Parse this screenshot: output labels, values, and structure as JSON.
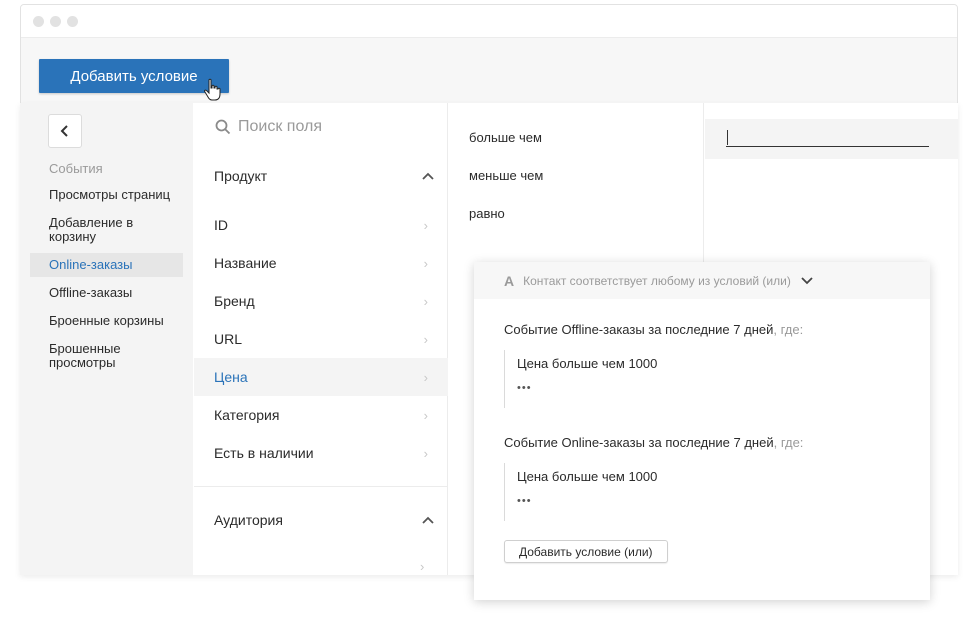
{
  "toolbar": {
    "add_condition_label": "Добавить условие"
  },
  "events_panel": {
    "heading": "События",
    "items": [
      {
        "label": "Просмотры страниц"
      },
      {
        "label": "Добавление в корзину"
      },
      {
        "label": "Online-заказы"
      },
      {
        "label": "Offline-заказы"
      },
      {
        "label": "Броенные корзины"
      },
      {
        "label": "Брошенные просмотры"
      }
    ],
    "active_item": "Online-заказы"
  },
  "fields_panel": {
    "search_placeholder": "Поиск поля",
    "groups": [
      {
        "label": "Продукт",
        "fields": [
          {
            "label": "ID"
          },
          {
            "label": "Название"
          },
          {
            "label": "Бренд"
          },
          {
            "label": "URL"
          },
          {
            "label": "Цена"
          },
          {
            "label": "Категория"
          },
          {
            "label": "Есть в наличии"
          }
        ]
      },
      {
        "label": "Аудитория"
      }
    ],
    "active_field": "Цена"
  },
  "operators_panel": {
    "items": [
      {
        "label": "больше чем"
      },
      {
        "label": "меньше чем"
      },
      {
        "label": "равно"
      }
    ]
  },
  "value_panel": {
    "value": ""
  },
  "condition_card": {
    "header_label": "Контакт соответствует любому из условий (или)",
    "header_icon": "text-a-icon",
    "conditions": [
      {
        "title_main": "Событие Offline-заказы  за последние  7 дней",
        "title_suffix": ", где:",
        "line": "Цена  больше чем 1000",
        "more": "•••"
      },
      {
        "title_main": "Событие Online-заказы  за последние  7 дней",
        "title_suffix": ", где:",
        "line": "Цена  больше чем 1000",
        "more": "•••"
      }
    ],
    "add_or_label": "Добавить условие (или)"
  },
  "colors": {
    "accent": "#2a73b9",
    "sidebar_bg": "#f4f4f4",
    "muted_text": "#9a9a9a"
  }
}
